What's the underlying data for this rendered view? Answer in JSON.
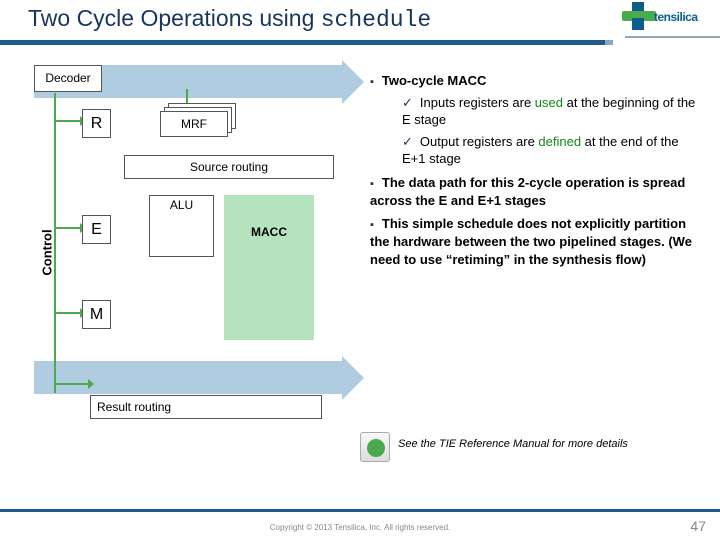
{
  "title_a": "Two Cycle Operations using ",
  "title_b": "schedule",
  "logo": "tensilica",
  "diagram": {
    "decoder": "Decoder",
    "R": "R",
    "E": "E",
    "M": "M",
    "mrf": "MRF",
    "src": "Source routing",
    "alu": "ALU",
    "macc": "MACC",
    "res": "Result routing",
    "control": "Control"
  },
  "bullets": {
    "b1": "Two-cycle MACC",
    "b1a_pre": "Inputs registers are ",
    "b1a_hl": "used",
    "b1a_post": " at the beginning of the E stage",
    "b1b_pre": "Output registers are ",
    "b1b_hl": "defined",
    "b1b_post": " at the end of the E+1 stage",
    "b2": "The data path for this 2-cycle operation is spread across the E and E+1 stages",
    "b3": "This simple schedule does not explicitly partition the hardware between the two pipelined stages. (We need to use “retiming” in the synthesis flow)"
  },
  "ref": "See the TIE Reference Manual for more details",
  "copyright": "Copyright © 2013  Tensilica, Inc. All rights reserved.",
  "page": "47"
}
